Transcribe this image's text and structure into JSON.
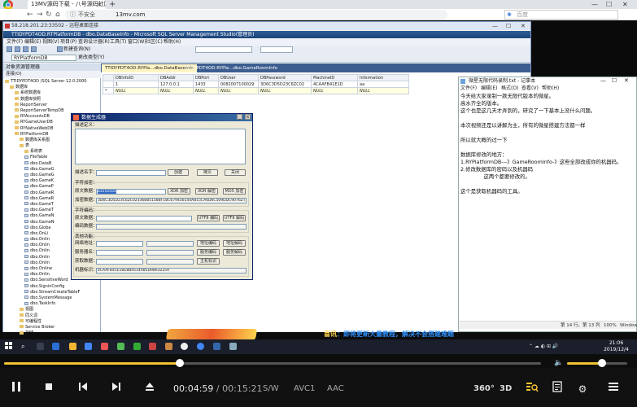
{
  "browser": {
    "tab_title": "13MV源码下载 - 八号源码社区",
    "address_secure_label": "不安全",
    "address_url": "13mv.com",
    "search_placeholder": "百度"
  },
  "rdp": {
    "title": "58.218.201.23:33502 - 远程桌面连接"
  },
  "ssms": {
    "title": "TTIDYPDT4OD.RTPlatformDB - dbo.DataBaseInfo - Microsoft SQL Server Management Studio(管理员)",
    "menu": [
      "文件(F)",
      "编辑(E)",
      "视图(V)",
      "项目(P)",
      "查询设计器(R)",
      "工具(T)",
      "窗口(W)",
      "社区(C)",
      "帮助(H)"
    ],
    "new_query": "新建查询(N)",
    "db_select": "RYPlatformDB",
    "exec": "更改类型(Y)",
    "oe_title": "对象资源管理器",
    "oe_toolbar": "连接(O)",
    "tree": [
      "TTIDYPDT4OD (SQL Server 12.0.2000",
      "数据库",
      "系统数据库",
      "数据库快照",
      "ReportServer",
      "ReportServerTempDB",
      "RYAccountsDB",
      "RYGameUserDB",
      "RYNativeWebDB",
      "RYPlatformDB",
      "数据库关系图",
      "表",
      "系统表",
      "FileTable",
      "dbo.DataB",
      "dbo.GameG",
      "dbo.GameG",
      "dbo.GameK",
      "dbo.GameP",
      "dbo.GameR",
      "dbo.GameR",
      "dbo.GameT",
      "dbo.GameT",
      "dbo.GameN",
      "dbo.GameN",
      "dbo.Globa",
      "dbo.OnLi",
      "dbo.Onlin",
      "dbo.Onlin",
      "dbo.Onlin",
      "dbo.Onlin",
      "dbo.Onlin",
      "dbo.Online",
      "dbo.Onlin",
      "dbo.SensitiveWord",
      "dbo.SigninConfig",
      "dbo.StreamCreateTableF",
      "dbo.SystemMessage",
      "dbo.TaskInfo",
      "视图",
      "同义词",
      "可编程性",
      "Service Broker",
      "存储"
    ],
    "doc_tabs": [
      "TTIDYPDT4OD.RYPla...dbo.DataBaseInfo",
      "TTIDYPDT4OD.RYPla...dbo.GameRoomInfo"
    ],
    "grid": {
      "columns": [
        "DBInfoID",
        "DBAddr",
        "DBPort",
        "DBUser",
        "DBPassword",
        "MachineID",
        "Information"
      ],
      "rows": [
        [
          "1",
          "127.0.0.1",
          "1433",
          "0082007100029",
          "3D6C3D5D23C6ZC02",
          "4CAAFB41E1D",
          "aa"
        ],
        [
          "NULL",
          "NULL",
          "NULL",
          "NULL",
          "NULL",
          "NULL",
          "NULL"
        ]
      ]
    }
  },
  "dialog": {
    "title": "数据生成器",
    "remark_label": "描述定义：",
    "key_label": "描述名字：",
    "btn_create": "创建",
    "btn_copy": "拷贝",
    "btn_close": "关闭",
    "encrypt_group": "字符加密：",
    "plain_label": "原文数据：",
    "plain_value": "a3152555",
    "btn_xor": "XOR 加密",
    "btn_xor_dec": "XOR 解密",
    "btn_md5": "MD5 加密",
    "cipher_label": "加密数据：",
    "cipher_value": "3D6C3D5D23C6ZC02336B85158BF1BC679430144AB15CA6D6C509DDC9076ZT",
    "encode_group": "字符编码：",
    "raw_label": "原文数据：",
    "enc_label": "编码数据：",
    "btn_utf8": "UTF8 编码",
    "btn_utf8_dec": "UTF8 解码",
    "other_group": "其他功能：",
    "net_label": "网络地址：",
    "server_label": "服务器名：",
    "db_label": "获取数据：",
    "machine_label": "机器标识：",
    "machine_value": "4CAAFB41E1BE8B4514A85D98632259",
    "btn_addr_enc": "地址编码",
    "btn_addr_dec": "地址解码",
    "btn_srv_enc": "服务编码",
    "btn_srv_dec": "服务解码",
    "btn_machine": "主机标识"
  },
  "notepad": {
    "title": "微星无限代码录制.txt - 记事本",
    "menu": [
      "文件(F)",
      "编辑(E)",
      "格式(O)",
      "查看(V)",
      "帮助(H)"
    ],
    "lines": [
      "今天给大家录制一款无限代版本的微星。",
      "高水齐全的版本。",
      "这个也是这几天才弄到的，研究了一下基本上没什么问题。",
      "",
      "本次视频还是以讲解为主，所有的微星搭建方法都一样",
      "",
      "所以就大概的过一下",
      "",
      "数据库修改的地方：",
      "1.RYPlatformDB---》GameRoomInfo-》这些全部改成你的机器码。",
      "2.修改数据库的密码以及机器码",
      "              这两个都要修改的。",
      "",
      "这个是获取机器码的工具。"
    ],
    "status_pos": "第 14 行，第 13 列",
    "status_zoom": "100%",
    "status_enc": "Windows (CRLF)"
  },
  "taskbar": {
    "time": "21:06",
    "date": "2019/12/4"
  },
  "banner": {
    "text_prefix": "喜讯",
    "text": "：即将更新大量教程，解决不会搭建难题"
  },
  "player": {
    "current_time": "00:04:59",
    "separator": "/",
    "total_time": "00:15:21",
    "progress": 0.327,
    "volume": 0.58,
    "subtitle_label": "S/W",
    "video_codec": "AVC1",
    "audio_codec": "AAC",
    "label_360": "360°",
    "label_3d": "3D"
  },
  "colors": {
    "accent": "#f2c230",
    "ssms_title": "#2d5c98",
    "taskbar": "#1b1f2b"
  }
}
